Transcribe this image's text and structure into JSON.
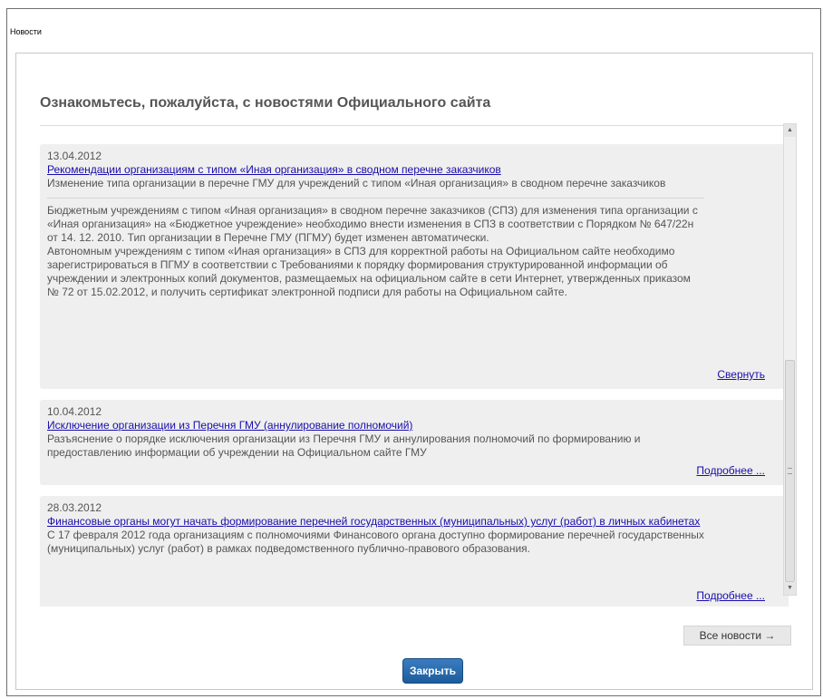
{
  "window": {
    "title": "Новости"
  },
  "dialog": {
    "heading": "Ознакомьтесь, пожалуйста, с новостями Официального сайта",
    "news": [
      {
        "date": "13.04.2012",
        "title": "Рекомендации организациям с типом «Иная организация» в сводном перечне заказчиков",
        "summary": "Изменение типа организации в перечне ГМУ для учреждений с типом «Иная организация» в сводном перечне заказчиков",
        "detail": "Бюджетным учреждениям с типом «Иная организация» в сводном перечне заказчиков (СПЗ) для изменения типа организации с «Иная организация» на «Бюджетное учреждение» необходимо внести изменения в СПЗ в соответствии с Порядком № 647/22н от 14. 12. 2010. Тип организации в Перечне ГМУ (ПГМУ) будет изменен автоматически.",
        "detail2": "Автономным учреждениям с типом «Иная организация» в СПЗ для корректной работы на Официальном сайте необходимо зарегистрироваться в ПГМУ в соответствии с Требованиями к порядку формирования структурированной информации об учреждении и электронных копий документов, размещаемых на официальном сайте в сети Интернет, утвержденных приказом № 72 от 15.02.2012, и получить сертификат электронной подписи для работы на Официальном сайте.",
        "link": "Свернуть"
      },
      {
        "date": "10.04.2012",
        "title": "Исключение организации из Перечня ГМУ (аннулирование полномочий)",
        "summary": "Разъяснение о порядке исключения организации из Перечня ГМУ и аннулирования полномочий по формированию и предоставлению информации об учреждении на Официальном сайте ГМУ",
        "link": "Подробнее ..."
      },
      {
        "date": "28.03.2012",
        "title": "Финансовые органы могут начать формирование перечней государственных (муниципальных) услуг (работ) в личных кабинетах",
        "summary": "С 17 февраля 2012 года организациям с полномочиями Финансового органа доступно формирование перечней государственных (муниципальных) услуг (работ) в рамках подведомственного публично-правового образования.",
        "link": "Подробнее ..."
      }
    ],
    "all_news_label": "Все новости →",
    "close_label": "Закрыть"
  },
  "icons": {
    "scroll_up": "triangle-up-icon",
    "scroll_down": "triangle-down-icon"
  },
  "colors": {
    "link": "#1a0dab",
    "card_bg": "#efefef",
    "close_button": "#2a6db0"
  }
}
